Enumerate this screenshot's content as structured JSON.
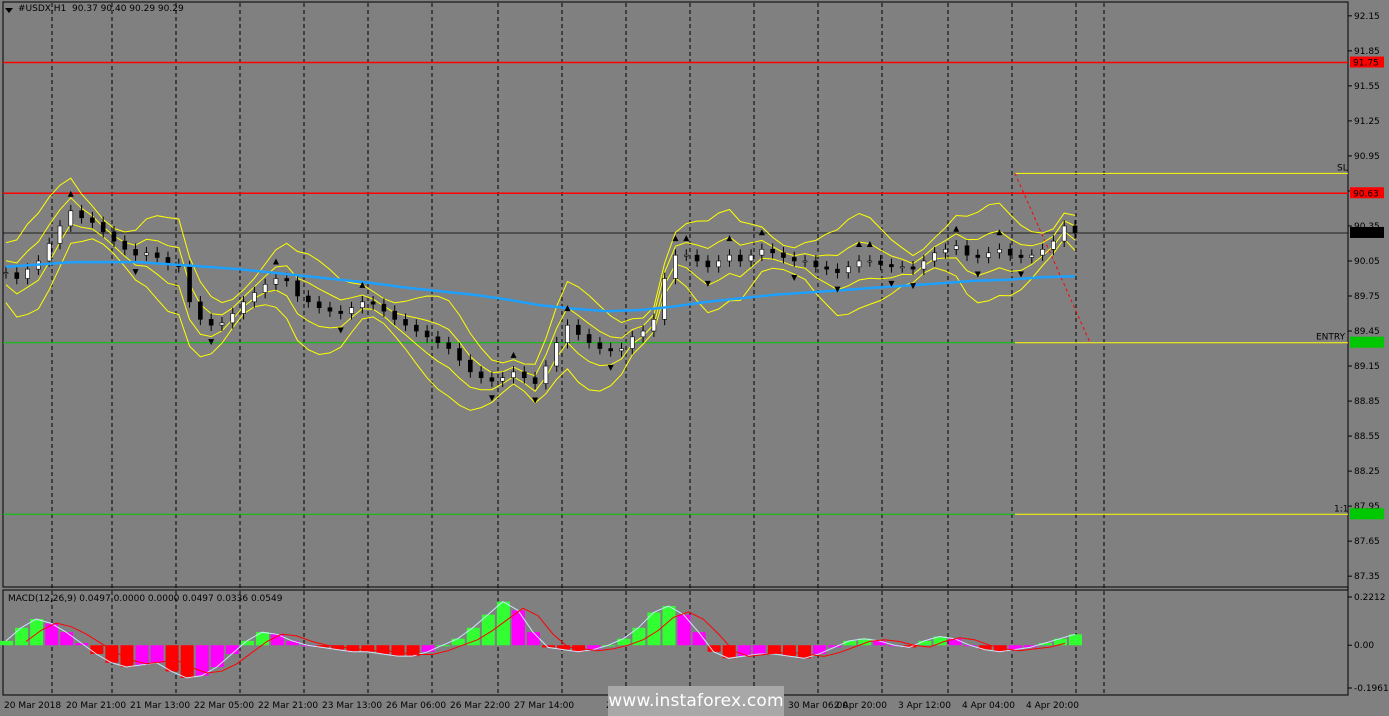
{
  "header": {
    "symbol": "#USDX,H1",
    "ohlc": "90.37 90.40 90.29 90.29"
  },
  "macd_header": "MACD(12,26,9) 0.0497 0.0000 0.0000 0.0497 0.0336 0.0549",
  "watermark": "www.instaforex.com",
  "colors": {
    "background": "#808080",
    "resistance": "#ff0000",
    "support": "#00c800",
    "trade_levels": "#ffff00",
    "ma": "#1ea0ff",
    "bands": "#ffff00",
    "hist_up": "#32ff32",
    "hist_down": "#ff0000",
    "hist_magenta": "#ff00ff",
    "signal": "#ff0000",
    "macd_line": "#c8e6ff"
  },
  "chart_data": [
    {
      "type": "line",
      "name": "price",
      "y_ticks": [
        "92.15",
        "91.85",
        "91.55",
        "91.25",
        "90.95",
        "90.65",
        "90.35",
        "90.05",
        "89.75",
        "89.45",
        "89.15",
        "88.85",
        "88.55",
        "88.25",
        "87.95",
        "87.65",
        "87.35"
      ],
      "ylim": [
        87.3,
        92.2
      ],
      "x_labels": [
        "20 Mar 2018",
        "20 Mar 21:00",
        "21 Mar 13:00",
        "22 Mar 05:00",
        "22 Mar 21:00",
        "23 Mar 13:00",
        "26 Mar 06:00",
        "26 Mar 22:00",
        "27 Mar 14:00",
        "28 Mar",
        "30 Mar 06:00",
        "2 Apr 20:00",
        "3 Apr 12:00",
        "4 Apr 04:00",
        "4 Apr 20:00"
      ],
      "levels": {
        "resistance_high": {
          "value": 91.75,
          "label": "91.75"
        },
        "resistance_low": {
          "value": 90.63,
          "label": "90.63"
        },
        "current": {
          "value": 90.29,
          "label": "90.29"
        },
        "sl": {
          "value": 90.8,
          "text": "SL"
        },
        "entry": {
          "value": 89.35,
          "text": "ENTRY"
        },
        "target": {
          "value": 87.88,
          "text": "1:1"
        }
      },
      "close": [
        89.95,
        89.9,
        89.98,
        90.05,
        90.2,
        90.35,
        90.48,
        90.42,
        90.38,
        90.3,
        90.22,
        90.15,
        90.1,
        90.12,
        90.08,
        90.02,
        90.0,
        89.7,
        89.55,
        89.5,
        89.52,
        89.6,
        89.7,
        89.78,
        89.85,
        89.9,
        89.88,
        89.75,
        89.7,
        89.65,
        89.62,
        89.6,
        89.65,
        89.7,
        89.68,
        89.62,
        89.55,
        89.5,
        89.45,
        89.4,
        89.35,
        89.3,
        89.2,
        89.1,
        89.05,
        89.02,
        89.05,
        89.1,
        89.05,
        89.0,
        89.15,
        89.35,
        89.5,
        89.42,
        89.35,
        89.3,
        89.28,
        89.3,
        89.4,
        89.45,
        89.55,
        89.9,
        90.1,
        90.1,
        90.05,
        90.0,
        90.05,
        90.1,
        90.05,
        90.1,
        90.15,
        90.12,
        90.08,
        90.05,
        90.05,
        90.0,
        89.98,
        89.95,
        90.0,
        90.05,
        90.05,
        90.02,
        90.0,
        90.0,
        89.98,
        90.05,
        90.12,
        90.15,
        90.18,
        90.1,
        90.08,
        90.12,
        90.15,
        90.1,
        90.08,
        90.1,
        90.15,
        90.22,
        90.35,
        90.29
      ],
      "ma200": [
        90.0,
        90.02,
        90.04,
        90.04,
        90.04,
        90.02,
        90.0,
        89.98,
        89.95,
        89.92,
        89.89,
        89.86,
        89.82,
        89.79,
        89.76,
        89.72,
        89.67,
        89.64,
        89.62,
        89.63,
        89.66,
        89.7,
        89.73,
        89.76,
        89.78,
        89.8,
        89.82,
        89.84,
        89.86,
        89.88,
        89.89,
        89.91,
        89.92
      ],
      "series": [
        {
          "name": "",
          "values": [
            0.02,
            0.08,
            0.12,
            0.1,
            0.06,
            0.01,
            -0.04,
            -0.08,
            -0.1,
            -0.09,
            -0.08,
            -0.12,
            -0.15,
            -0.14,
            -0.1,
            -0.04,
            0.02,
            0.06,
            0.05,
            0.02,
            0.0,
            -0.01,
            -0.02,
            -0.03,
            -0.03,
            -0.04,
            -0.05,
            -0.05,
            -0.03,
            0.0,
            0.03,
            0.08,
            0.14,
            0.2,
            0.16,
            0.06,
            -0.01,
            -0.02,
            -0.03,
            -0.02,
            0.0,
            0.03,
            0.08,
            0.15,
            0.18,
            0.14,
            0.06,
            -0.03,
            -0.06,
            -0.05,
            -0.04,
            -0.04,
            -0.05,
            -0.06,
            -0.04,
            -0.01,
            0.02,
            0.03,
            0.02,
            0.0,
            -0.01,
            0.02,
            0.04,
            0.03,
            0.0,
            -0.02,
            -0.03,
            -0.02,
            -0.01,
            0.01,
            0.03,
            0.05
          ]
        }
      ],
      "macd_ticks": [
        "0.2212",
        "0.00",
        "-0.1961"
      ],
      "macd_ylim": [
        -0.1961,
        0.2212
      ]
    }
  ]
}
